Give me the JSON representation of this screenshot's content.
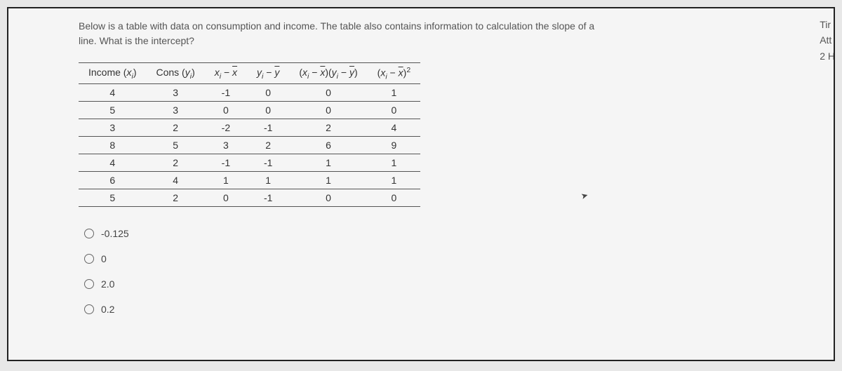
{
  "question": {
    "line1": "Below is a table with data on consumption and income. The table also contains information to calculation the slope of a",
    "line2": "line. What is the intercept?"
  },
  "headers": {
    "h1": "Income (xᵢ)",
    "h2": "Cons (yᵢ)",
    "h3": "xᵢ − x̄",
    "h4": "yᵢ − ȳ",
    "h5": "(xᵢ − x̄)(yᵢ − ȳ)",
    "h6": "(xᵢ − x̄)²"
  },
  "rows": [
    {
      "c1": "4",
      "c2": "3",
      "c3": "-1",
      "c4": "0",
      "c5": "0",
      "c6": "1"
    },
    {
      "c1": "5",
      "c2": "3",
      "c3": "0",
      "c4": "0",
      "c5": "0",
      "c6": "0"
    },
    {
      "c1": "3",
      "c2": "2",
      "c3": "-2",
      "c4": "-1",
      "c5": "2",
      "c6": "4"
    },
    {
      "c1": "8",
      "c2": "5",
      "c3": "3",
      "c4": "2",
      "c5": "6",
      "c6": "9"
    },
    {
      "c1": "4",
      "c2": "2",
      "c3": "-1",
      "c4": "-1",
      "c5": "1",
      "c6": "1"
    },
    {
      "c1": "6",
      "c2": "4",
      "c3": "1",
      "c4": "1",
      "c5": "1",
      "c6": "1"
    },
    {
      "c1": "5",
      "c2": "2",
      "c3": "0",
      "c4": "-1",
      "c5": "0",
      "c6": "0"
    }
  ],
  "options": {
    "o1": "-0.125",
    "o2": "0",
    "o3": "2.0",
    "o4": "0.2"
  },
  "right": {
    "r1": "Tir",
    "r2": "Att",
    "r3": "2 H"
  }
}
